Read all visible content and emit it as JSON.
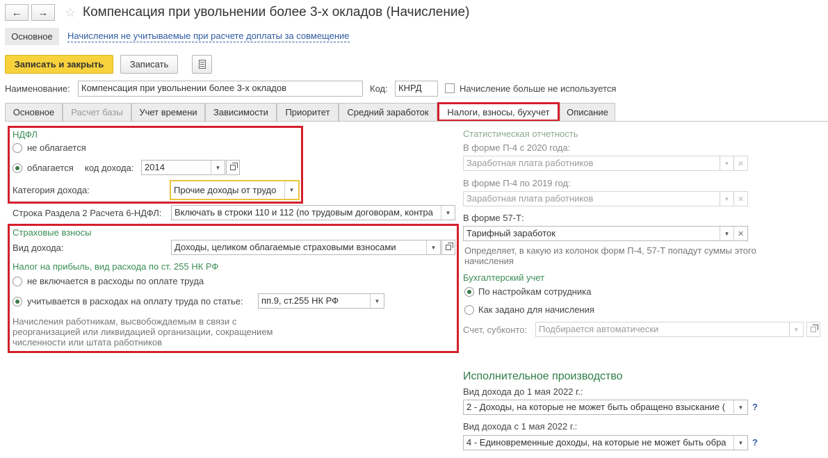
{
  "window": {
    "title": "Компенсация при увольнении более 3-х окладов (Начисление)"
  },
  "subtabs": {
    "main": "Основное",
    "link": "Начисления не учитываемые при расчете доплаты за совмещение"
  },
  "toolbar": {
    "save_close": "Записать и закрыть",
    "save": "Записать"
  },
  "form": {
    "name_label": "Наименование:",
    "name_value": "Компенсация при увольнении более 3-х окладов",
    "code_label": "Код:",
    "code_value": "КНРД",
    "unused_label": "Начисление больше не используется"
  },
  "tabs": [
    {
      "label": "Основное"
    },
    {
      "label": "Расчет базы"
    },
    {
      "label": "Учет времени"
    },
    {
      "label": "Зависимости"
    },
    {
      "label": "Приоритет"
    },
    {
      "label": "Средний заработок"
    },
    {
      "label": "Налоги, взносы, бухучет"
    },
    {
      "label": "Описание"
    }
  ],
  "ndfl": {
    "title": "НДФЛ",
    "opt_no": "не облагается",
    "opt_yes": "облагается",
    "code_label": "код дохода:",
    "code_value": "2014",
    "category_label": "Категория дохода:",
    "category_value": "Прочие доходы от трудо",
    "row6_label": "Строка Раздела 2 Расчета 6-НДФЛ:",
    "row6_value": "Включать в строки 110 и 112 (по трудовым договорам, контра"
  },
  "insurance": {
    "title": "Страховые взносы",
    "income_label": "Вид дохода:",
    "income_value": "Доходы, целиком облагаемые страховыми взносами",
    "profit_title": "Налог на прибыль, вид расхода по ст. 255 НК РФ",
    "opt_not": "не включается в расходы по оплате труда",
    "opt_yes": "учитывается в расходах на оплату труда по статье:",
    "article_value": "пп.9, ст.255 НК РФ",
    "hint": "Начисления работникам, высвобождаемым в связи с реорганизацией или ликвидацией организации, сокращением численности или штата работников"
  },
  "stats": {
    "title": "Статистическая отчетность",
    "p4_2020_label": "В форме П-4 с 2020 года:",
    "p4_2020_value": "Заработная плата работников",
    "p4_2019_label": "В форме П-4 по 2019 год:",
    "p4_2019_value": "Заработная плата работников",
    "f57_label": "В форме 57-Т:",
    "f57_value": "Тарифный заработок",
    "hint": "Определяет, в какую из колонок форм П-4, 57-Т попадут суммы этого начисления"
  },
  "accounting": {
    "title": "Бухгалтерский учет",
    "opt_employee": "По настройкам сотрудника",
    "opt_accrual": "Как задано для начисления",
    "account_label": "Счет, субконто:",
    "account_value": "Подбирается автоматически"
  },
  "enforcement": {
    "title": "Исполнительное производство",
    "before_label": "Вид дохода до 1 мая 2022 г.:",
    "before_value": "2 - Доходы, на которые не может быть обращено взыскание (",
    "after_label": "Вид дохода с 1 мая 2022 г.:",
    "after_value": "4 - Единовременные доходы, на которые не может быть обра",
    "help": "?"
  }
}
